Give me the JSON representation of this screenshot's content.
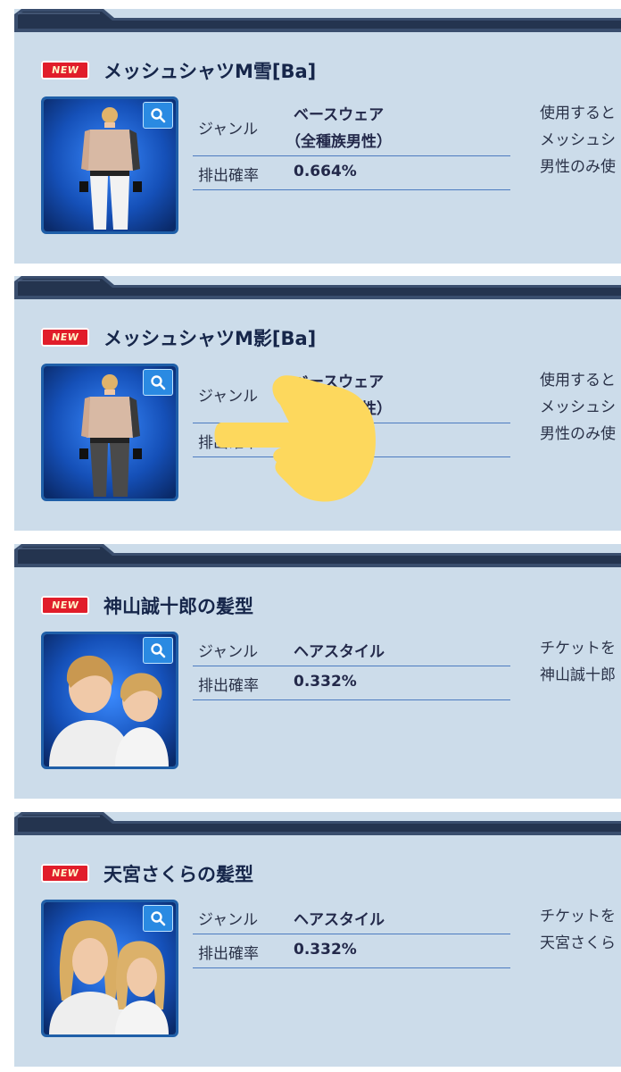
{
  "cards": [
    {
      "badge": "NEW",
      "title": "メッシュシャツM雪[Ba]",
      "genre_label": "ジャンル",
      "genre_value_1": "ベースウェア",
      "genre_value_2": "（全種族男性）",
      "rate_label": "排出確率",
      "rate_value": "0.664%",
      "desc_1": "使用すると",
      "desc_2": "メッシュシ",
      "desc_3": "男性のみ使"
    },
    {
      "badge": "NEW",
      "title": "メッシュシャツM影[Ba]",
      "genre_label": "ジャンル",
      "genre_value_1": "ベースウェア",
      "genre_value_2": "（全種族男性）",
      "rate_label": "排出確率",
      "rate_value": "",
      "desc_1": "使用すると",
      "desc_2": "メッシュシ",
      "desc_3": "男性のみ使"
    },
    {
      "badge": "NEW",
      "title": "神山誠十郎の髪型",
      "genre_label": "ジャンル",
      "genre_value_1": "ヘアスタイル",
      "rate_label": "排出確率",
      "rate_value": "0.332%",
      "desc_1": "チケットを",
      "desc_2": "神山誠十郎"
    },
    {
      "badge": "NEW",
      "title": "天宮さくらの髪型",
      "genre_label": "ジャンル",
      "genre_value_1": "ヘアスタイル",
      "rate_label": "排出確率",
      "rate_value": "0.332%",
      "desc_1": "チケットを",
      "desc_2": "天宮さくら"
    }
  ],
  "icons": {
    "zoom": "magnifier-icon",
    "overlay": "hand-pointer-emoji"
  },
  "colors": {
    "card_bg": "#ccdcea",
    "header_bar": "#2c3e5c",
    "title_text": "#16264a",
    "divider": "#4c7bc0",
    "badge_red": "#e11d2a",
    "thumb_border": "#1f5fa8",
    "overlay_yellow": "#fdd85d"
  }
}
